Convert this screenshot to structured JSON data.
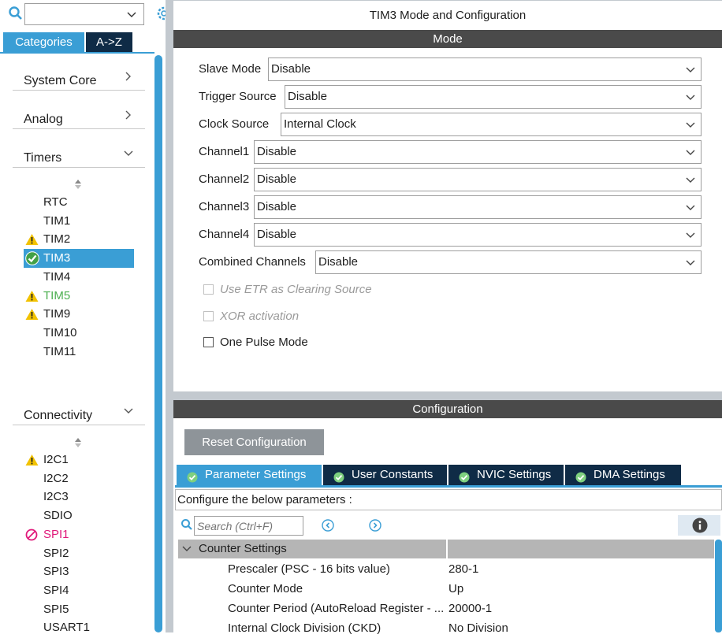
{
  "left": {
    "search": {
      "value": ""
    },
    "tabs": {
      "categories": "Categories",
      "az": "A->Z"
    },
    "groups": {
      "system_core": "System Core",
      "analog": "Analog",
      "timers": "Timers",
      "connectivity": "Connectivity"
    },
    "timers": [
      {
        "label": "RTC",
        "status": "none"
      },
      {
        "label": "TIM1",
        "status": "none"
      },
      {
        "label": "TIM2",
        "status": "warning"
      },
      {
        "label": "TIM3",
        "status": "ok"
      },
      {
        "label": "TIM4",
        "status": "none"
      },
      {
        "label": "TIM5",
        "status": "warning"
      },
      {
        "label": "TIM9",
        "status": "warning"
      },
      {
        "label": "TIM10",
        "status": "none"
      },
      {
        "label": "TIM11",
        "status": "none"
      }
    ],
    "connectivity": [
      {
        "label": "I2C1",
        "status": "warning"
      },
      {
        "label": "I2C2",
        "status": "none"
      },
      {
        "label": "I2C3",
        "status": "none"
      },
      {
        "label": "SDIO",
        "status": "none"
      },
      {
        "label": "SPI1",
        "status": "disabled"
      },
      {
        "label": "SPI2",
        "status": "none"
      },
      {
        "label": "SPI3",
        "status": "none"
      },
      {
        "label": "SPI4",
        "status": "none"
      },
      {
        "label": "SPI5",
        "status": "none"
      },
      {
        "label": "USART1",
        "status": "none"
      }
    ]
  },
  "header": {
    "title": "TIM3 Mode and Configuration"
  },
  "mode": {
    "section_title": "Mode",
    "fields": [
      {
        "label": "Slave Mode",
        "value": "Disable"
      },
      {
        "label": "Trigger Source",
        "value": "Disable"
      },
      {
        "label": "Clock Source",
        "value": "Internal Clock"
      },
      {
        "label": "Channel1",
        "value": "Disable"
      },
      {
        "label": "Channel2",
        "value": "Disable"
      },
      {
        "label": "Channel3",
        "value": "Disable"
      },
      {
        "label": "Channel4",
        "value": "Disable"
      },
      {
        "label": "Combined Channels",
        "value": "Disable"
      }
    ],
    "checkboxes": [
      {
        "label": "Use ETR as Clearing Source",
        "checked": false,
        "enabled": false
      },
      {
        "label": "XOR activation",
        "checked": false,
        "enabled": false
      },
      {
        "label": "One Pulse Mode",
        "checked": false,
        "enabled": true
      }
    ]
  },
  "config": {
    "section_title": "Configuration",
    "reset_label": "Reset Configuration",
    "tabs": [
      "Parameter Settings",
      "User Constants",
      "NVIC Settings",
      "DMA Settings"
    ],
    "hint": "Configure the below parameters :",
    "search_placeholder": "Search (Ctrl+F)",
    "group_title": "Counter Settings",
    "params": [
      {
        "name": "Prescaler (PSC - 16 bits value)",
        "value": "280-1"
      },
      {
        "name": "Counter Mode",
        "value": "Up"
      },
      {
        "name": "Counter Period (AutoReload Register - ...",
        "value": "20000-1"
      },
      {
        "name": "Internal Clock Division (CKD)",
        "value": "No Division"
      }
    ]
  },
  "colors": {
    "accent": "#3a9ed5",
    "dark_bar": "#4a4a4a",
    "tab_dark": "#0f2b46",
    "warning": "#f2c200",
    "ok": "#43a047",
    "error": "#e0187a",
    "tim5_text": "#4caf50"
  }
}
